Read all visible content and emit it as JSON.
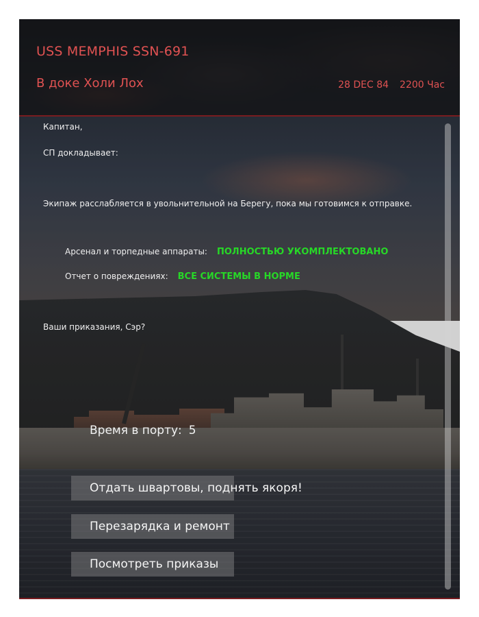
{
  "header": {
    "vessel_name": "USS MEMPHIS SSN-691",
    "location": "В доке Холи Лох",
    "date": "28 DEC 84",
    "time": "2200 Час"
  },
  "report": {
    "greeting": "Капитан,",
    "reporter": "СП докладывает:",
    "crew_status": "Экипаж расслабляется в увольнительной на Берегу, пока мы готовимся к отправке.",
    "arsenal_label": "Арсенал и торпедные аппараты:",
    "arsenal_value": "ПОЛНОСТЬЮ УКОМПЛЕКТОВАНО",
    "damage_label": "Отчет о повреждениях:",
    "damage_value": "ВСЕ СИСТЕМЫ В НОРМЕ",
    "question": "Ваши приказания, Сэр?"
  },
  "port_time": {
    "label": "Время в порту:",
    "value": "5"
  },
  "actions": [
    {
      "label": "Отдать швартовы, поднять якоря!"
    },
    {
      "label": "Перезарядка и ремонт"
    },
    {
      "label": "Посмотреть приказы"
    }
  ],
  "colors": {
    "accent_red": "#e05252",
    "status_green": "#27d827",
    "divider": "#7a1c20"
  }
}
